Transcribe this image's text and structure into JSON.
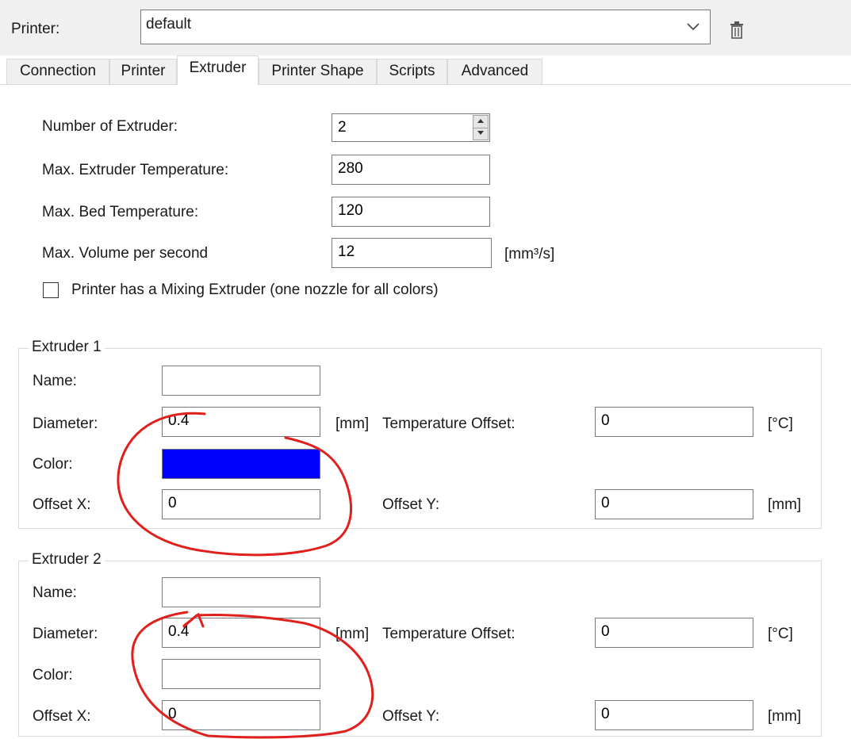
{
  "header": {
    "printer_label": "Printer:",
    "printer_value": "default"
  },
  "tabs": [
    {
      "label": "Connection"
    },
    {
      "label": "Printer"
    },
    {
      "label": "Extruder"
    },
    {
      "label": "Printer Shape"
    },
    {
      "label": "Scripts"
    },
    {
      "label": "Advanced"
    }
  ],
  "general": {
    "num_extruder_label": "Number of Extruder:",
    "num_extruder_value": "2",
    "max_extruder_temp_label": "Max. Extruder Temperature:",
    "max_extruder_temp_value": "280",
    "max_bed_temp_label": "Max. Bed Temperature:",
    "max_bed_temp_value": "120",
    "max_volume_label": "Max. Volume per second",
    "max_volume_value": "12",
    "max_volume_unit": "[mm³/s]",
    "mixing_label": "Printer has a Mixing Extruder (one nozzle for all colors)"
  },
  "extruders": [
    {
      "title": "Extruder 1",
      "name_label": "Name:",
      "name_value": "",
      "diameter_label": "Diameter:",
      "diameter_value": "0.4",
      "diameter_unit": "[mm]",
      "temp_offset_label": "Temperature Offset:",
      "temp_offset_value": "0",
      "temp_offset_unit": "[°C]",
      "color_label": "Color:",
      "color_hex": "#0000ff",
      "offset_x_label": "Offset X:",
      "offset_x_value": "0",
      "offset_y_label": "Offset Y:",
      "offset_y_value": "0",
      "offset_unit": "[mm]"
    },
    {
      "title": "Extruder 2",
      "name_label": "Name:",
      "name_value": "",
      "diameter_label": "Diameter:",
      "diameter_value": "0.4",
      "diameter_unit": "[mm]",
      "temp_offset_label": "Temperature Offset:",
      "temp_offset_value": "0",
      "temp_offset_unit": "[°C]",
      "color_label": "Color:",
      "color_hex": "#ffffff",
      "offset_x_label": "Offset X:",
      "offset_x_value": "0",
      "offset_y_label": "Offset Y:",
      "offset_y_value": "0",
      "offset_unit": "[mm]"
    }
  ],
  "icons": {
    "combo_arrow": "chevron-down-icon",
    "delete": "trash-icon",
    "spinner": "spinner-arrows-icon"
  },
  "colors": {
    "annotation": "#e0201c"
  }
}
